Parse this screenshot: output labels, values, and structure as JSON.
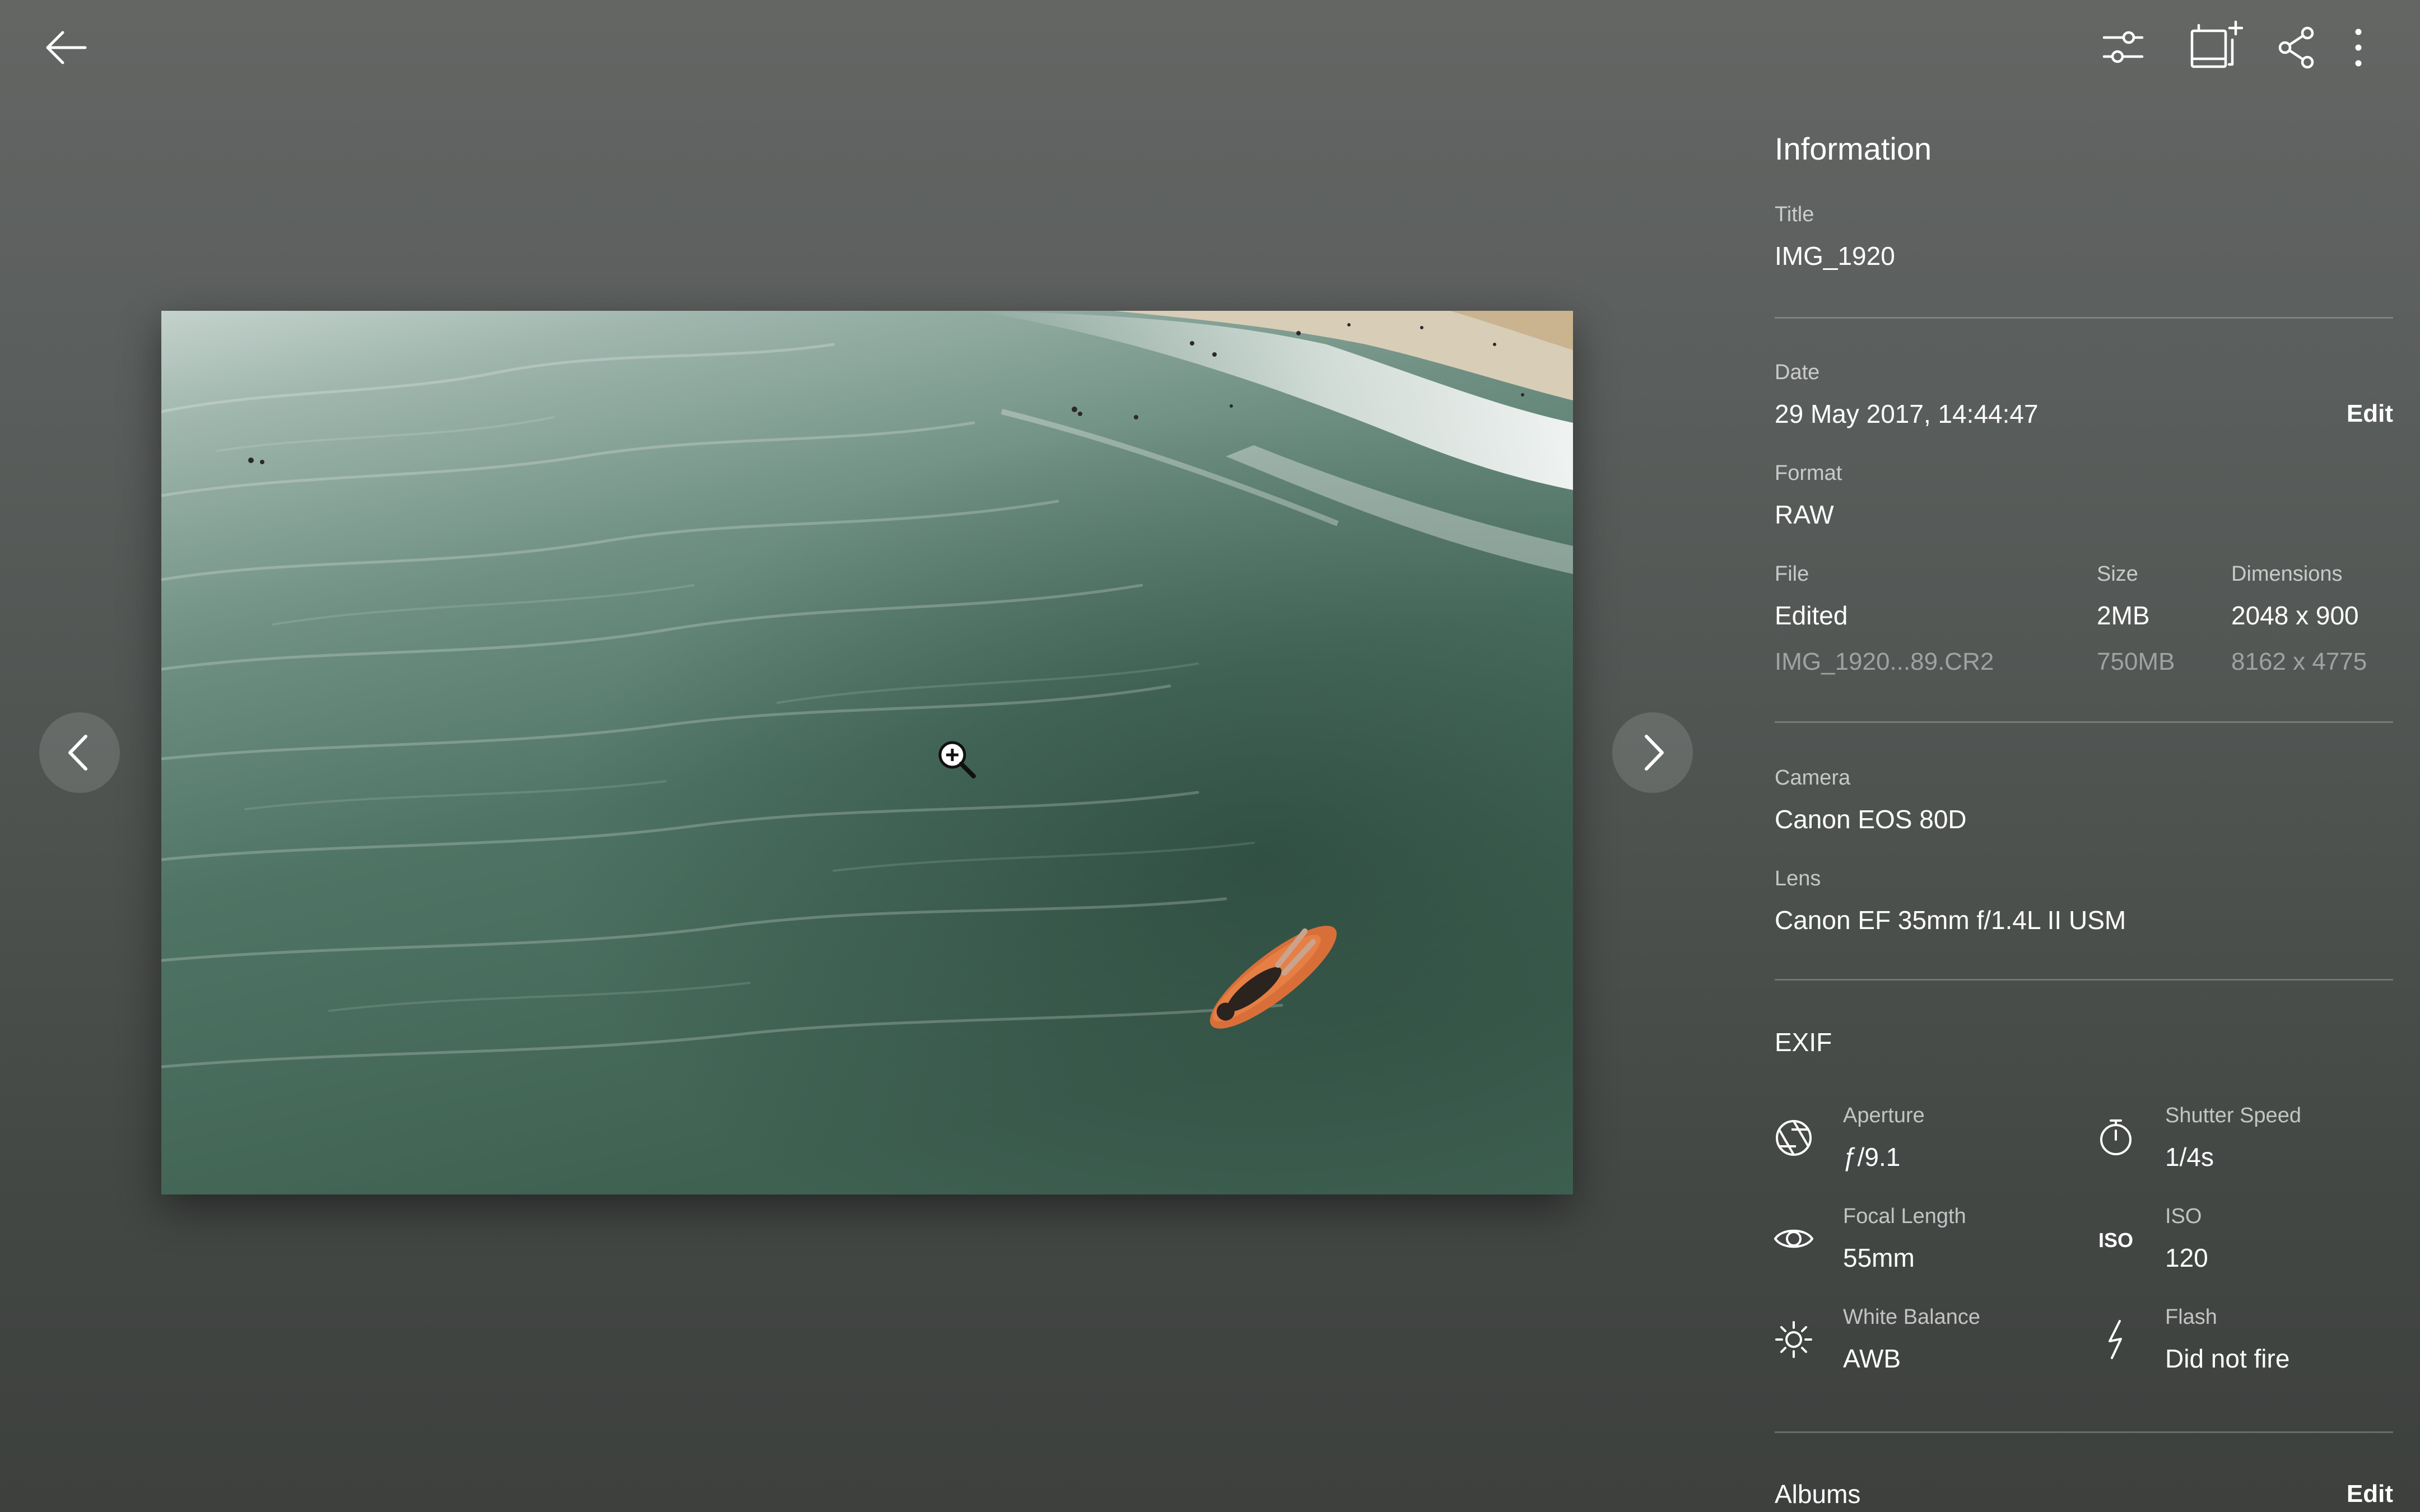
{
  "toolbar": {
    "back_icon": "arrow-left-icon",
    "actions": [
      "adjust-sliders-icon",
      "add-to-album-icon",
      "share-icon",
      "more-vert-icon"
    ]
  },
  "viewer": {
    "prev_icon": "chevron-left-icon",
    "next_icon": "chevron-right-icon",
    "zoom_cursor_icon": "zoom-in-icon"
  },
  "info": {
    "heading": "Information",
    "title_label": "Title",
    "title_value": "IMG_1920",
    "date_label": "Date",
    "date_value": "29 May 2017, 14:44:47",
    "date_edit": "Edit",
    "format_label": "Format",
    "format_value": "RAW",
    "file_label": "File",
    "size_label": "Size",
    "dimensions_label": "Dimensions",
    "edited": {
      "file": "Edited",
      "size": "2MB",
      "dimensions": "2048 x 900"
    },
    "original": {
      "file": "IMG_1920...89.CR2",
      "size": "750MB",
      "dimensions": "8162 x 4775"
    },
    "camera_label": "Camera",
    "camera_value": "Canon EOS 80D",
    "lens_label": "Lens",
    "lens_value": "Canon EF 35mm f/1.4L II USM"
  },
  "exif": {
    "heading": "EXIF",
    "aperture_label": "Aperture",
    "aperture_value": "ƒ/9.1",
    "shutter_label": "Shutter Speed",
    "shutter_value": "1/4s",
    "focal_label": "Focal Length",
    "focal_value": "55mm",
    "iso_icon_text": "ISO",
    "iso_label": "ISO",
    "iso_value": "120",
    "wb_label": "White Balance",
    "wb_value": "AWB",
    "flash_label": "Flash",
    "flash_value": "Did not fire"
  },
  "albums": {
    "heading": "Albums",
    "edit": "Edit"
  }
}
